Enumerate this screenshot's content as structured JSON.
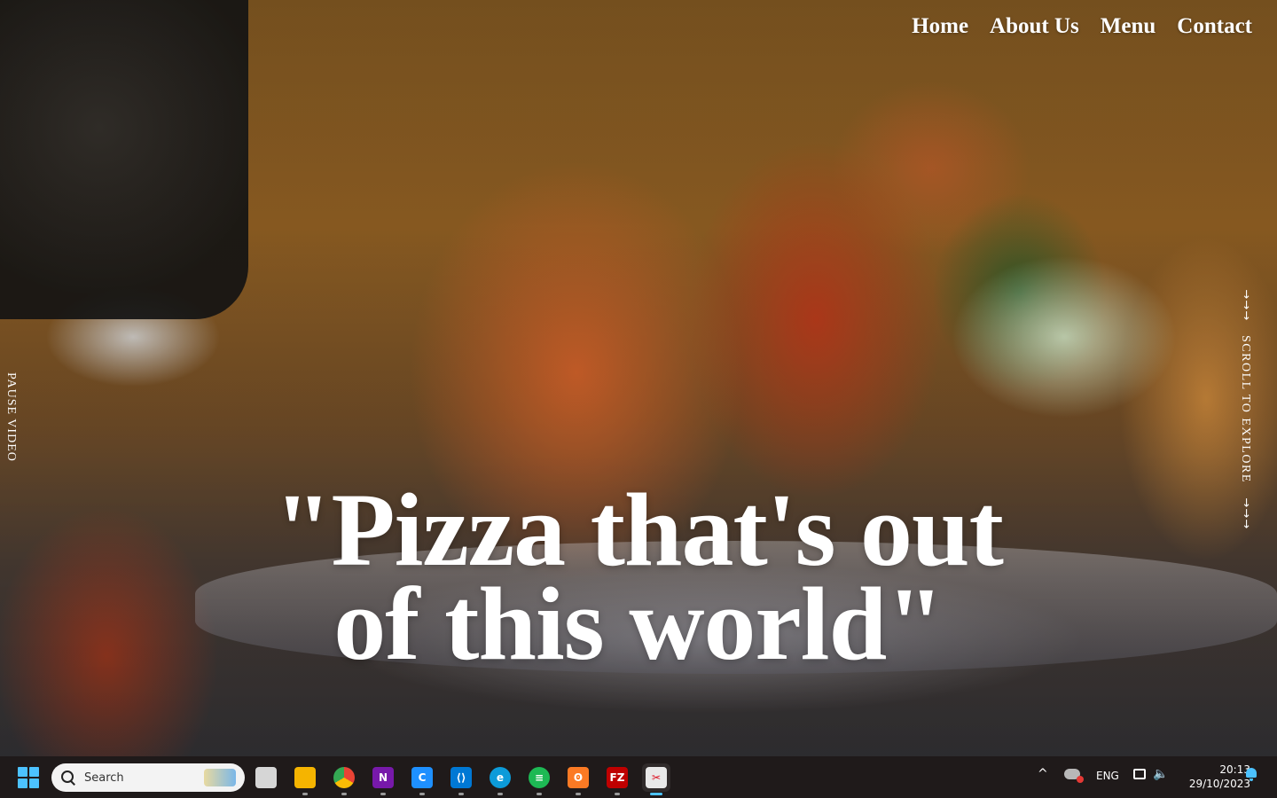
{
  "nav": {
    "items": [
      {
        "label": "Home"
      },
      {
        "label": "About Us"
      },
      {
        "label": "Menu"
      },
      {
        "label": "Contact"
      }
    ]
  },
  "hero": {
    "headline_line1": "\"Pizza that's out",
    "headline_line2": "of this world\"",
    "pause_label": "PAUSE VIDEO",
    "scroll_label": "SCROLL TO EXPLORE",
    "arrow_glyph": "→"
  },
  "taskbar": {
    "search_placeholder": "Search",
    "apps": [
      {
        "name": "task-view",
        "label": "",
        "color": "#d6d6d6"
      },
      {
        "name": "file-explorer",
        "label": "",
        "color": "#f5b400"
      },
      {
        "name": "chrome",
        "label": "",
        "color": "#34a853"
      },
      {
        "name": "onenote",
        "label": "N",
        "color": "#7719aa"
      },
      {
        "name": "app-c",
        "label": "C",
        "color": "#1e90ff"
      },
      {
        "name": "vscode",
        "label": "⟨⟩",
        "color": "#0078d4"
      },
      {
        "name": "edge",
        "label": "e",
        "color": "#0c9bd9"
      },
      {
        "name": "spotify",
        "label": "≡",
        "color": "#1db954"
      },
      {
        "name": "xampp",
        "label": "ʘ",
        "color": "#fb7a24"
      },
      {
        "name": "filezilla",
        "label": "FZ",
        "color": "#bf0000"
      },
      {
        "name": "snipping-tool",
        "label": "✂",
        "color": "#e9e9e9"
      }
    ],
    "tray": {
      "language": "ENG",
      "time": "20:13",
      "date": "29/10/2023"
    }
  }
}
